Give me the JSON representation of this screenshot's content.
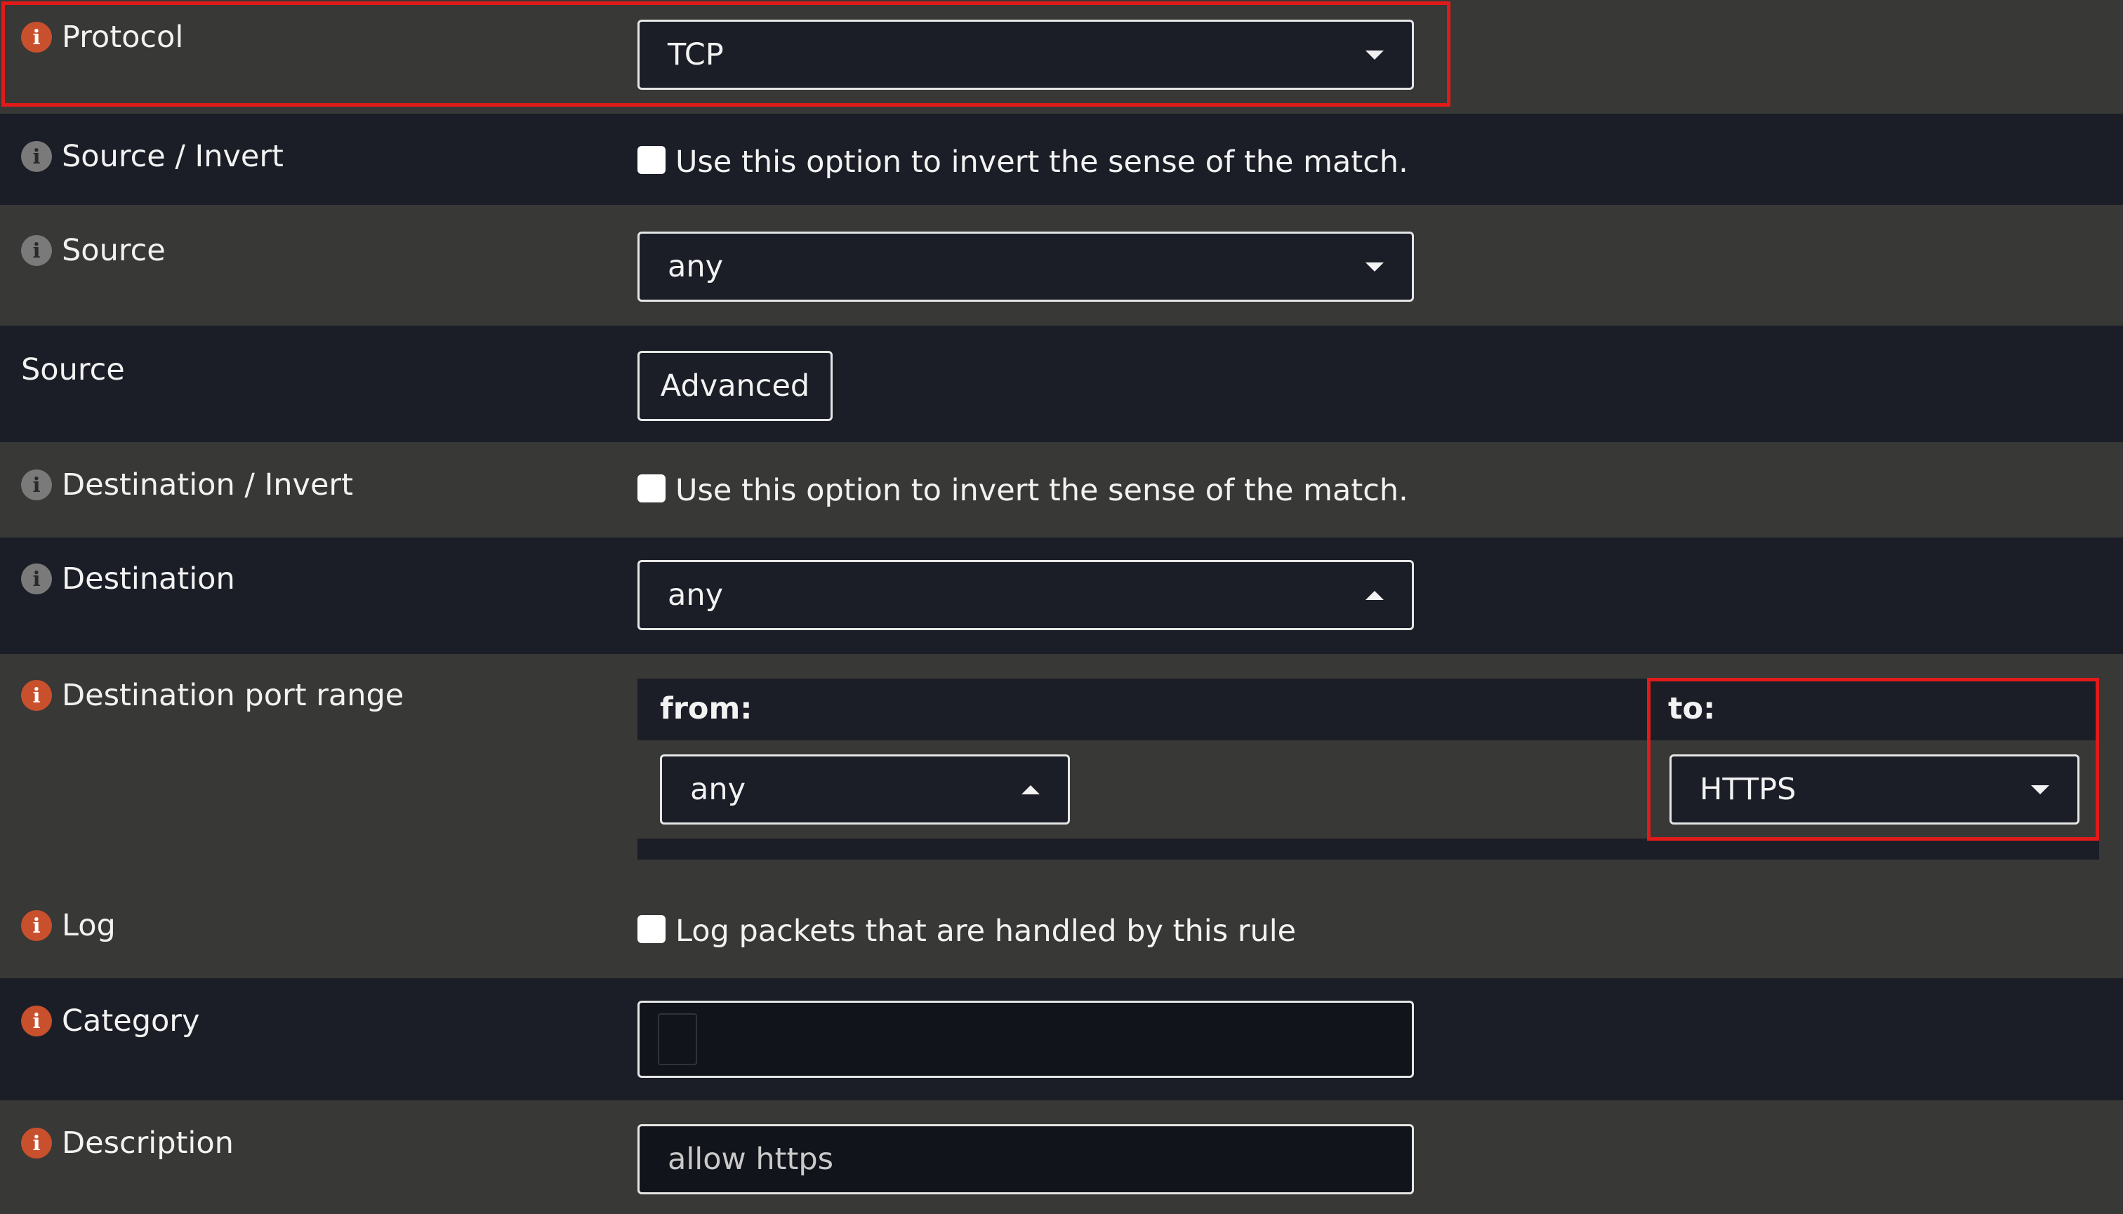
{
  "rows": {
    "protocol": {
      "label": "Protocol",
      "value": "TCP"
    },
    "source_invert": {
      "label": "Source / Invert",
      "checkbox_text": "Use this option to invert the sense of the match."
    },
    "source": {
      "label": "Source",
      "value": "any"
    },
    "source_advanced": {
      "label": "Source",
      "button": "Advanced"
    },
    "dest_invert": {
      "label": "Destination / Invert",
      "checkbox_text": "Use this option to invert the sense of the match."
    },
    "destination": {
      "label": "Destination",
      "value": "any"
    },
    "port_range": {
      "label": "Destination port range",
      "from_label": "from:",
      "from_value": "any",
      "to_label": "to:",
      "to_value": "HTTPS"
    },
    "log": {
      "label": "Log",
      "checkbox_text": "Log packets that are handled by this rule"
    },
    "category": {
      "label": "Category",
      "value": ""
    },
    "description": {
      "label": "Description",
      "value": "allow https"
    }
  },
  "icons": {
    "info": "i",
    "orange_color": "#c9502c",
    "gray_color": "#7a7a7a"
  },
  "colors": {
    "highlight": "#e21a1a"
  }
}
